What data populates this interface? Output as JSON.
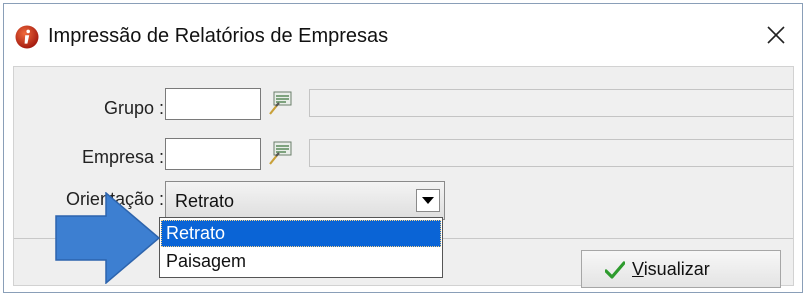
{
  "window": {
    "title": "Impressão de Relatórios de Empresas"
  },
  "icons": {
    "app": "info-icon",
    "close": "close-icon",
    "lookup": "lookup-icon",
    "dropdown": "chevron-down-icon",
    "check": "check-icon",
    "annotation": "arrow-right-icon"
  },
  "form": {
    "grupo": {
      "label": "Grupo :",
      "code_value": "",
      "name_value": ""
    },
    "empresa": {
      "label": "Empresa :",
      "code_value": "",
      "name_value": ""
    },
    "orientacao": {
      "label": "Orientação :",
      "selected": "Retrato",
      "options": [
        "Retrato",
        "Paisagem"
      ],
      "highlighted": "Retrato"
    }
  },
  "buttons": {
    "visualizar": "Visualizar"
  },
  "colors": {
    "selection": "#0a64d6",
    "arrow": "#3d7fd1",
    "check": "#2e9b2e",
    "app_icon": "#c8321e"
  }
}
